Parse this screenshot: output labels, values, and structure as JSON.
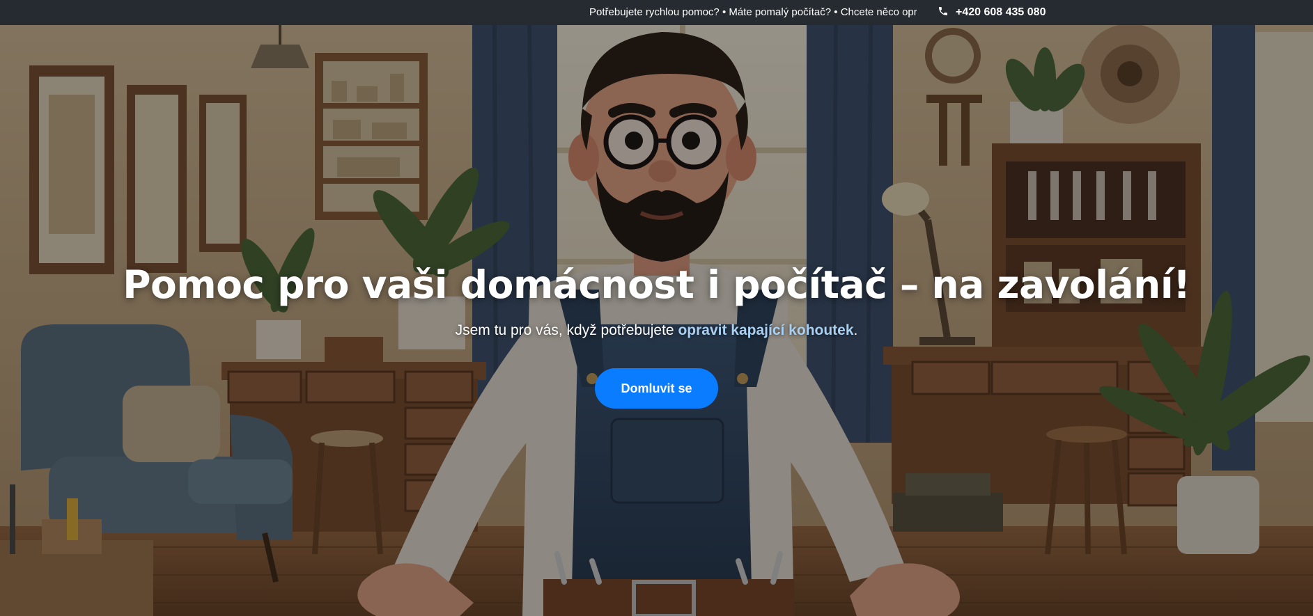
{
  "topbar": {
    "ticker_text": "Potřebujete rychlou pomoc? • Máte pomalý počítač? • Chcete něco opravit?",
    "phone_number": "+420 608 435 080",
    "phone_icon": "phone-icon"
  },
  "hero": {
    "title": "Pomoc pro vaši domácnost i počítač – na zavolání!",
    "subtitle_prefix": "Jsem tu pro vás, když potřebujete ",
    "subtitle_highlight": "opravit kapající kohoutek",
    "subtitle_suffix": ".",
    "cta_label": "Domluvit se"
  },
  "colors": {
    "topbar_bg": "#252b31",
    "cta_bg": "#0a7cff",
    "highlight": "#a9cff1"
  }
}
